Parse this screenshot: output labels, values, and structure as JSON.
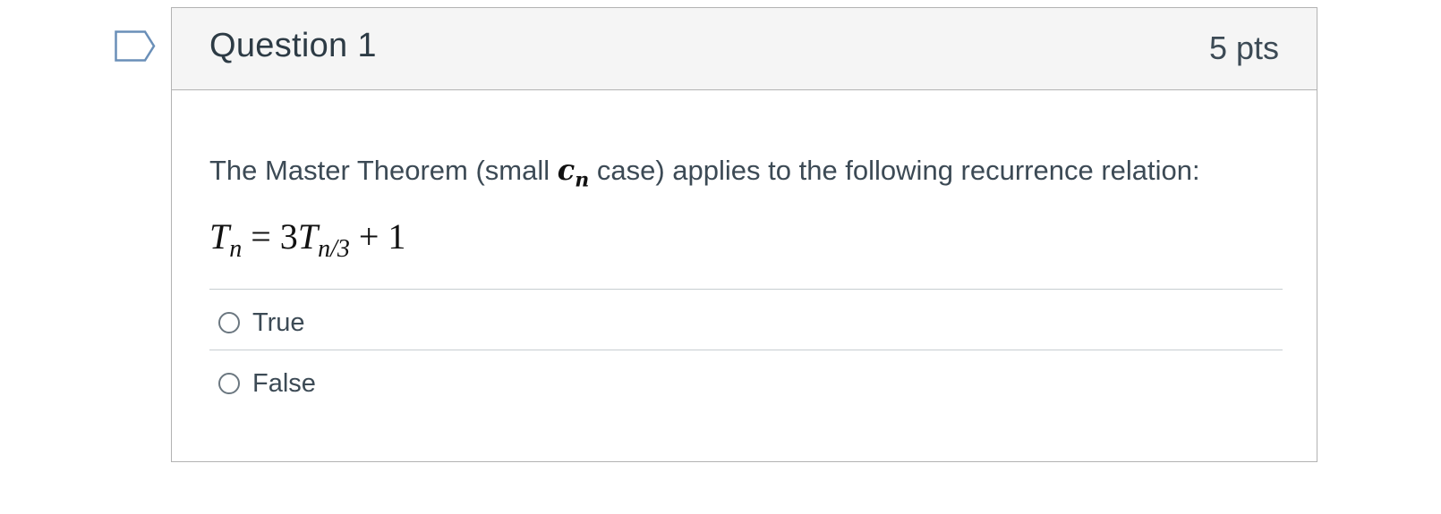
{
  "question": {
    "title": "Question 1",
    "points": "5 pts",
    "text_before": "The Master Theorem (small ",
    "inline_math_base": "c",
    "inline_math_sub": "n",
    "text_after": " case) applies to the following recurrence relation:",
    "equation": {
      "lhs_base": "T",
      "lhs_sub": "n",
      "equals": " = 3",
      "rhs_base": "T",
      "rhs_sub": "n/3",
      "rest": " + 1"
    }
  },
  "answers": [
    {
      "label": "True",
      "selected": false
    },
    {
      "label": "False",
      "selected": false
    }
  ],
  "colors": {
    "header_bg": "#f5f5f5",
    "flag_stroke": "#6a8fb8",
    "border": "#b3b3b3"
  }
}
